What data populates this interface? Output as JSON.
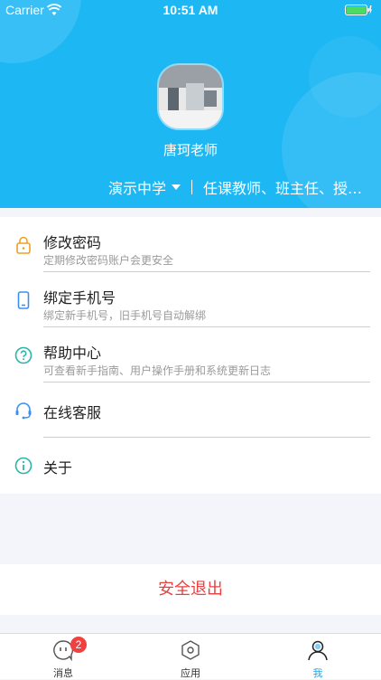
{
  "status_bar": {
    "carrier": "Carrier",
    "time": "10:51 AM"
  },
  "profile": {
    "name": "唐珂老师",
    "school": "演示中学",
    "roles": "任课教师、班主任、授权..."
  },
  "menu": {
    "items": [
      {
        "title": "修改密码",
        "subtitle": "定期修改密码账户会更安全",
        "icon": "lock-icon"
      },
      {
        "title": "绑定手机号",
        "subtitle": "绑定新手机号，旧手机号自动解绑",
        "icon": "phone-icon"
      },
      {
        "title": "帮助中心",
        "subtitle": "可查看新手指南、用户操作手册和系统更新日志",
        "icon": "help-icon"
      },
      {
        "title": "在线客服",
        "icon": "headset-icon"
      },
      {
        "title": "关于",
        "icon": "info-icon"
      }
    ]
  },
  "logout_label": "安全退出",
  "tabbar": {
    "tabs": [
      {
        "label": "消息",
        "badge": "2",
        "icon": "message-icon"
      },
      {
        "label": "应用",
        "icon": "apps-icon"
      },
      {
        "label": "我",
        "icon": "profile-icon",
        "active": true
      }
    ]
  },
  "colors": {
    "header": "#1db7f4",
    "accent": "#1ea8ef",
    "logout": "#e8413f",
    "badge": "#f04141",
    "lock": "#f0a020",
    "info": "#2bb5a8"
  }
}
